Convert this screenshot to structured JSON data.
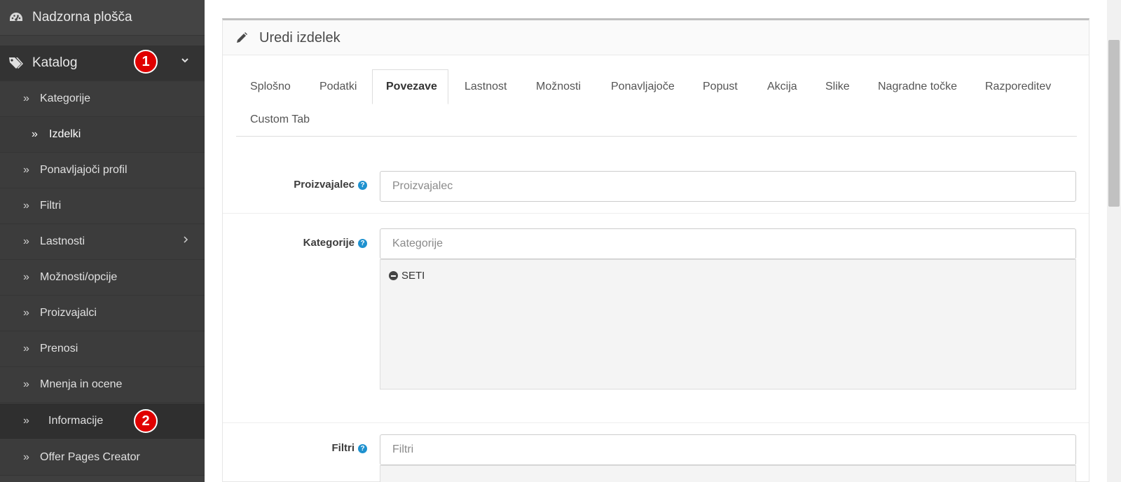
{
  "sidebar": {
    "dashboard": "Nadzorna plošča",
    "catalog": "Katalog",
    "badge1": "1",
    "badge2": "2",
    "items": [
      {
        "label": "Kategorije"
      },
      {
        "label": "Izdelki"
      },
      {
        "label": "Ponavljajoči profil"
      },
      {
        "label": "Filtri"
      },
      {
        "label": "Lastnosti"
      },
      {
        "label": "Možnosti/opcije"
      },
      {
        "label": "Proizvajalci"
      },
      {
        "label": "Prenosi"
      },
      {
        "label": "Mnenja in ocene"
      },
      {
        "label": "Informacije"
      },
      {
        "label": "Offer Pages Creator"
      }
    ]
  },
  "panel": {
    "title": "Uredi izdelek"
  },
  "tabs": [
    "Splošno",
    "Podatki",
    "Povezave",
    "Lastnost",
    "Možnosti",
    "Ponavljajoče",
    "Popust",
    "Akcija",
    "Slike",
    "Nagradne točke",
    "Razporeditev",
    "Custom Tab"
  ],
  "form": {
    "manufacturer": {
      "label": "Proizvajalec",
      "placeholder": "Proizvajalec"
    },
    "categories": {
      "label": "Kategorije",
      "placeholder": "Kategorije",
      "selected": [
        "SETI"
      ]
    },
    "filters": {
      "label": "Filtri",
      "placeholder": "Filtri"
    }
  },
  "icons": {
    "dashboard": "dashboard-icon",
    "catalog": "tags-icon",
    "edit": "pencil-icon",
    "help": "question-circle-icon",
    "remove": "minus-circle-icon"
  }
}
